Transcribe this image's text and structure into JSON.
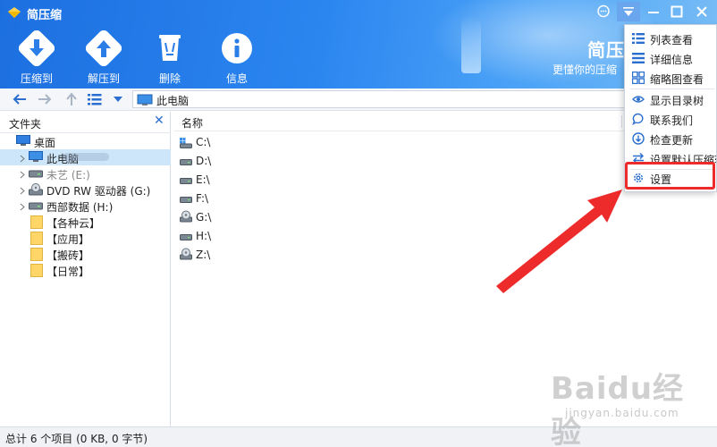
{
  "app": {
    "title": "简压缩"
  },
  "window_controls": [
    "feedback",
    "menu",
    "minimize",
    "maximize",
    "close"
  ],
  "toolbar": {
    "buttons": [
      {
        "label": "压缩到",
        "icon": "download-arrow-icon"
      },
      {
        "label": "解压到",
        "icon": "upload-arrow-icon"
      },
      {
        "label": "删除",
        "icon": "trash-icon"
      },
      {
        "label": "信息",
        "icon": "info-icon"
      }
    ]
  },
  "brand": {
    "title": "简压",
    "slogan": "更懂你的压缩"
  },
  "navbar": {
    "address": "此电脑"
  },
  "left_panel": {
    "title": "文件夹",
    "tree": [
      {
        "label": "桌面",
        "icon": "desktop-icon"
      },
      {
        "label": "此电脑",
        "icon": "computer-icon",
        "selected": true
      },
      {
        "label": "未艺 (E:)",
        "icon": "drive-icon"
      },
      {
        "label": "DVD RW 驱动器 (G:)",
        "icon": "dvd-icon"
      },
      {
        "label": "西部数据 (H:)",
        "icon": "drive-icon"
      },
      {
        "label": "【各种云】",
        "icon": "folder-icon"
      },
      {
        "label": "【应用】",
        "icon": "folder-icon"
      },
      {
        "label": "【搬砖】",
        "icon": "folder-icon"
      },
      {
        "label": "【日常】",
        "icon": "folder-icon"
      }
    ]
  },
  "file_list": {
    "column_name": "名称",
    "rows": [
      {
        "label": "C:\\",
        "icon": "windows-drive-icon"
      },
      {
        "label": "D:\\",
        "icon": "drive-icon"
      },
      {
        "label": "E:\\",
        "icon": "drive-icon"
      },
      {
        "label": "F:\\",
        "icon": "drive-icon"
      },
      {
        "label": "G:\\",
        "icon": "dvd-icon"
      },
      {
        "label": "H:\\",
        "icon": "drive-icon"
      },
      {
        "label": "Z:\\",
        "icon": "dvd-icon"
      }
    ]
  },
  "status": {
    "text": "总计 6 个项目 (0 KB, 0 字节)"
  },
  "menu": {
    "items": [
      {
        "label": "列表查看",
        "icon": "list-view-icon"
      },
      {
        "label": "详细信息",
        "icon": "details-icon"
      },
      {
        "label": "缩略图查看",
        "icon": "thumbnail-icon"
      },
      {
        "label": "显示目录树",
        "icon": "eye-icon"
      },
      {
        "label": "联系我们",
        "icon": "chat-icon"
      },
      {
        "label": "检查更新",
        "icon": "update-icon"
      },
      {
        "label": "设置默认压缩软件",
        "icon": "swap-icon"
      },
      {
        "label": "设置",
        "icon": "gear-icon",
        "highlighted": true
      }
    ]
  },
  "watermark": {
    "brand": "Baidu经验",
    "sub": "jingyan.baidu.com"
  },
  "colors": {
    "header": "#2b86f0",
    "accent": "#2a6fcf",
    "highlight": "#ee2b2b",
    "selection": "#cde6fa"
  }
}
